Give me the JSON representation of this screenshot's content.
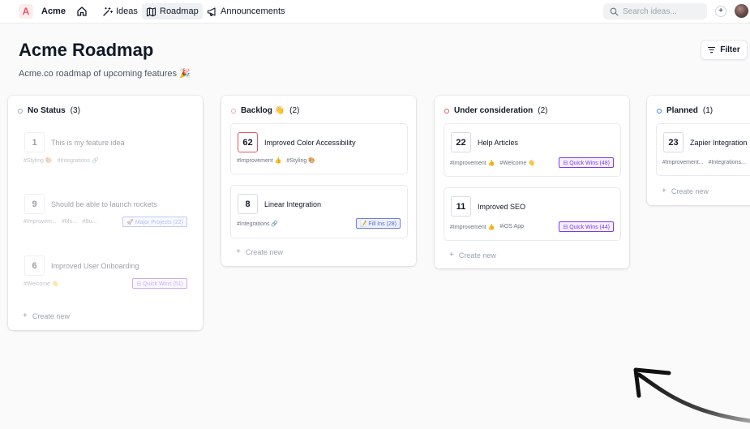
{
  "topbar": {
    "brand_letter": "A",
    "brand_name": "Acme",
    "nav": [
      {
        "label": "Ideas",
        "icon": "magic-wand-icon"
      },
      {
        "label": "Roadmap",
        "icon": "map-icon"
      },
      {
        "label": "Announcements",
        "icon": "megaphone-icon"
      }
    ],
    "search_placeholder": "Search ideas...",
    "add_symbol": "+"
  },
  "header": {
    "title": "Acme Roadmap",
    "subtitle": "Acme.co roadmap of upcoming features 🎉",
    "filter_label": "Filter"
  },
  "colors": {
    "accent": "#e25563",
    "purple_badge": "#7c3aed",
    "blue_badge": "#4f6ad8",
    "status_gray": "#9ca3af",
    "status_orange": "#f4a5b0",
    "status_red": "#e25563",
    "status_blue": "#3b82f6"
  },
  "columns": [
    {
      "name": "No Status",
      "count": "(3)",
      "cards": [
        {
          "votes": "1",
          "title": "This is my feature idea",
          "tags": [
            "#Styling 🎨",
            "#Integrations 🔗"
          ],
          "badge": ""
        },
        {
          "votes": "9",
          "title": "Should be able to launch rockets",
          "tags": [
            "#Improvem...",
            "#Mo...",
            "#Bu..."
          ],
          "badge": "🚀 Major Projects (22)"
        },
        {
          "votes": "6",
          "title": "Improved User Onboarding",
          "tags": [
            "#Welcome 👋"
          ],
          "badge": "⊟ Quick Wins (51)"
        }
      ],
      "create_label": "Create new"
    },
    {
      "name": "Backlog 👋",
      "count": "(2)",
      "cards": [
        {
          "votes": "62",
          "title": "Improved Color Accessibility",
          "tags": [
            "#Improvement 👍",
            "#Styling 🎨"
          ],
          "badge": ""
        },
        {
          "votes": "8",
          "title": "Linear Integration",
          "tags": [
            "#Integrations 🔗"
          ],
          "badge": "📝 Fill Ins (28)"
        }
      ],
      "create_label": "Create new"
    },
    {
      "name": "Under consideration",
      "count": "(2)",
      "cards": [
        {
          "votes": "22",
          "title": "Help Articles",
          "tags": [
            "#Improvement 👍",
            "#Welcome 👋"
          ],
          "badge": "⊟ Quick Wins (48)"
        },
        {
          "votes": "11",
          "title": "Improved SEO",
          "tags": [
            "#Improvement 👍",
            "#iOS App"
          ],
          "badge": "⊟ Quick Wins (44)"
        }
      ],
      "create_label": "Create new"
    },
    {
      "name": "Planned",
      "count": "(1)",
      "cards": [
        {
          "votes": "23",
          "title": "Zapier Integration",
          "tags": [
            "#Improvement...",
            "#Integrations..."
          ],
          "badge": ""
        }
      ],
      "create_label": "Create new"
    }
  ]
}
